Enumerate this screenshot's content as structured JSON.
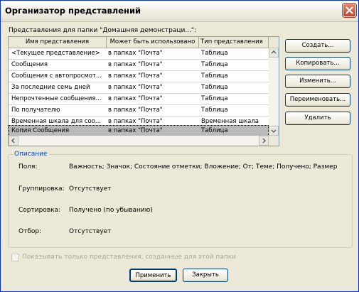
{
  "window": {
    "title": "Организатор представлений"
  },
  "views_label": "Представления для папки \"Домашняя демонстраци...\":",
  "table": {
    "headers": [
      "Имя представления",
      "Может быть использовано",
      "Тип представления"
    ],
    "rows": [
      [
        "<Текущее представление>",
        "в папках \"Почта\"",
        "Таблица"
      ],
      [
        "Сообщения",
        "в папках \"Почта\"",
        "Таблица"
      ],
      [
        "Сообщения с автопросмот...",
        "в папках \"Почта\"",
        "Таблица"
      ],
      [
        "За последние семь дней",
        "в папках \"Почта\"",
        "Таблица"
      ],
      [
        "Непрочтенные сообщения...",
        "в папках \"Почта\"",
        "Таблица"
      ],
      [
        "По получателю",
        "в папках \"Почта\"",
        "Таблица"
      ],
      [
        "Временная шкала для соо...",
        "в папках \"Почта\"",
        "Временная шкала"
      ],
      [
        "Копия Сообщения",
        "в папках \"Почта\"",
        "Таблица"
      ]
    ],
    "selected_index": 7
  },
  "buttons": {
    "create": "Создать...",
    "copy": "Копировать...",
    "modify": "Изменить...",
    "rename": "Переименовать...",
    "delete": "Удалить",
    "apply": "Применить",
    "close": "Закрыть"
  },
  "description": {
    "legend": "Описание",
    "fields_label": "Поля:",
    "fields_value": "Важность; Значок; Состояние отметки; Вложение; От; Теме; Получено; Размер",
    "grouping_label": "Группировка:",
    "grouping_value": "Отсутствует",
    "sorting_label": "Сортировка:",
    "sorting_value": "Получено (по убыванию)",
    "filter_label": "Отбор:",
    "filter_value": "Отсутствует"
  },
  "checkbox": {
    "label": "Показывать только представления, созданные для этой папки",
    "checked": false,
    "enabled": false
  }
}
